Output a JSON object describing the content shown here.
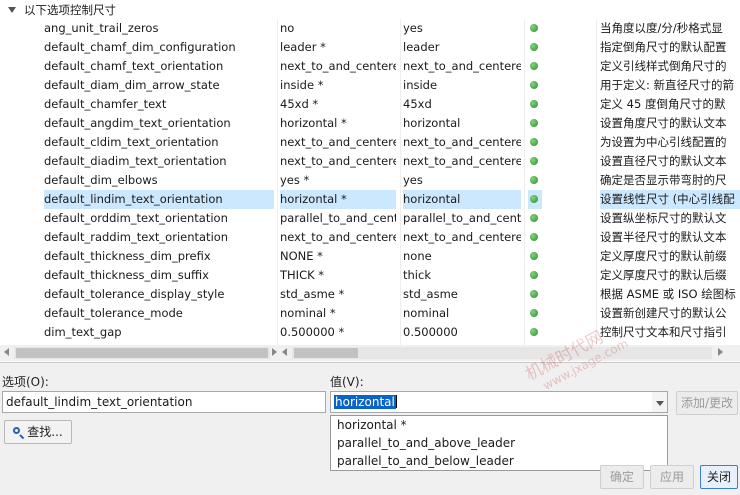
{
  "group_label": "以下选项控制尺寸",
  "rows": [
    {
      "name": "ang_unit_trail_zeros",
      "value": "no",
      "default": "yes",
      "desc": "当角度以度/分/秒格式显"
    },
    {
      "name": "default_chamf_dim_configuration",
      "value": "leader *",
      "default": "leader",
      "desc": "指定倒角尺寸的默认配置"
    },
    {
      "name": "default_chamf_text_orientation",
      "value": "next_to_and_centered",
      "default": "next_to_and_centered",
      "desc": "定义引线样式倒角尺寸的"
    },
    {
      "name": "default_diam_dim_arrow_state",
      "value": "inside *",
      "default": "inside",
      "desc": "用于定义: 新直径尺寸的箭"
    },
    {
      "name": "default_chamfer_text",
      "value": "45xd *",
      "default": "45xd",
      "desc": "定义 45 度倒角尺寸的默"
    },
    {
      "name": "default_angdim_text_orientation",
      "value": "horizontal *",
      "default": "horizontal",
      "desc": "设置角度尺寸的默认文本"
    },
    {
      "name": "default_cldim_text_orientation",
      "value": "next_to_and_centered",
      "default": "next_to_and_centered",
      "desc": "为设置为中心引线配置的"
    },
    {
      "name": "default_diadim_text_orientation",
      "value": "next_to_and_centered",
      "default": "next_to_and_centered",
      "desc": "设置直径尺寸的默认文本"
    },
    {
      "name": "default_dim_elbows",
      "value": "yes *",
      "default": "yes",
      "desc": "确定是否显示带弯肘的尺"
    },
    {
      "name": "default_lindim_text_orientation",
      "value": "horizontal *",
      "default": "horizontal",
      "desc": "设置线性尺寸 (中心引线配"
    },
    {
      "name": "default_orddim_text_orientation",
      "value": "parallel_to_and_center",
      "default": "parallel_to_and_center",
      "desc": "设置纵坐标尺寸的默认文"
    },
    {
      "name": "default_raddim_text_orientation",
      "value": "next_to_and_centered",
      "default": "next_to_and_centered",
      "desc": "设置半径尺寸的默认文本"
    },
    {
      "name": "default_thickness_dim_prefix",
      "value": "NONE *",
      "default": "none",
      "desc": "定义厚度尺寸的默认前缀"
    },
    {
      "name": "default_thickness_dim_suffix",
      "value": "THICK *",
      "default": "thick",
      "desc": "定义厚度尺寸的默认后缀"
    },
    {
      "name": "default_tolerance_display_style",
      "value": "std_asme *",
      "default": "std_asme",
      "desc": "根据 ASME 或 ISO 绘图标"
    },
    {
      "name": "default_tolerance_mode",
      "value": "nominal *",
      "default": "nominal",
      "desc": "设置新创建尺寸的默认公"
    },
    {
      "name": "dim_text_gap",
      "value": "0.500000 *",
      "default": "0.500000",
      "desc": "控制尺寸文本和尺寸指引"
    }
  ],
  "selected_index": 9,
  "status_color": "#2e8b2e",
  "highlight_color": "#cce8ff",
  "option_label": "选项(O):",
  "option_value": "default_lindim_text_orientation",
  "value_label": "值(V):",
  "value_current": "horizontal",
  "value_options": [
    "horizontal *",
    "parallel_to_and_above_leader",
    "parallel_to_and_below_leader"
  ],
  "find_button": "查找...",
  "add_change_button": "添加/更改",
  "ok_button": "确定",
  "apply_button": "应用",
  "close_button": "关闭",
  "watermark": "机械时代网",
  "watermark_url": "www.jxage.com"
}
